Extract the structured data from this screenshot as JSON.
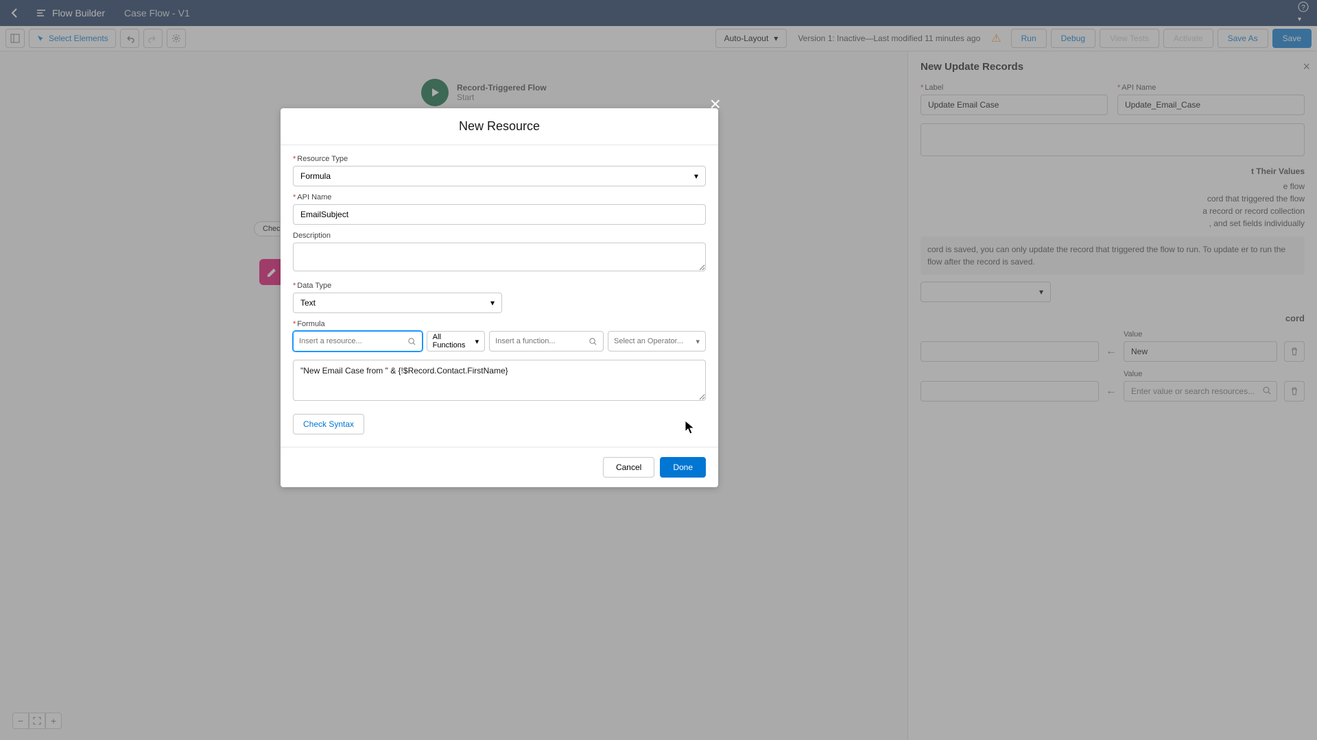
{
  "header": {
    "flow_builder": "Flow Builder",
    "flow_name": "Case Flow - V1"
  },
  "toolbar": {
    "select_elements": "Select Elements",
    "auto_layout": "Auto-Layout",
    "version_text": "Version 1: Inactive—Last modified 11 minutes ago",
    "run": "Run",
    "debug": "Debug",
    "view_tests": "View Tests",
    "activate": "Activate",
    "save_as": "Save As",
    "save": "Save"
  },
  "canvas": {
    "start_title": "Record-Triggered Flow",
    "start_sub": "Start",
    "decision_label": "Check Em"
  },
  "panel": {
    "title": "New Update Records",
    "label_label": "Label",
    "label_value": "Update Email Case",
    "api_label": "API Name",
    "api_value": "Update_Email_Case",
    "how_title": "t Their Values",
    "opt1": "e flow",
    "opt2": "cord that triggered the flow",
    "opt3": "a record or record collection",
    "opt4": ", and set fields individually",
    "info": "cord is saved, you can only update the record that triggered the flow to run. To update er to run the flow after the record is saved.",
    "sub_title2": "cord",
    "value_label": "Value",
    "value1": "New",
    "value2_placeholder": "Enter value or search resources..."
  },
  "modal": {
    "title": "New Resource",
    "resource_type_label": "Resource Type",
    "resource_type_value": "Formula",
    "api_name_label": "API Name",
    "api_name_value": "EmailSubject",
    "description_label": "Description",
    "data_type_label": "Data Type",
    "data_type_value": "Text",
    "formula_label": "Formula",
    "resource_placeholder": "Insert a resource...",
    "functions_label": "All Functions",
    "function_placeholder": "Insert a function...",
    "operator_placeholder": "Select an Operator...",
    "formula_text": "\"New Email Case from \" & {!$Record.Contact.FirstName}",
    "check_syntax": "Check Syntax",
    "cancel": "Cancel",
    "done": "Done"
  }
}
